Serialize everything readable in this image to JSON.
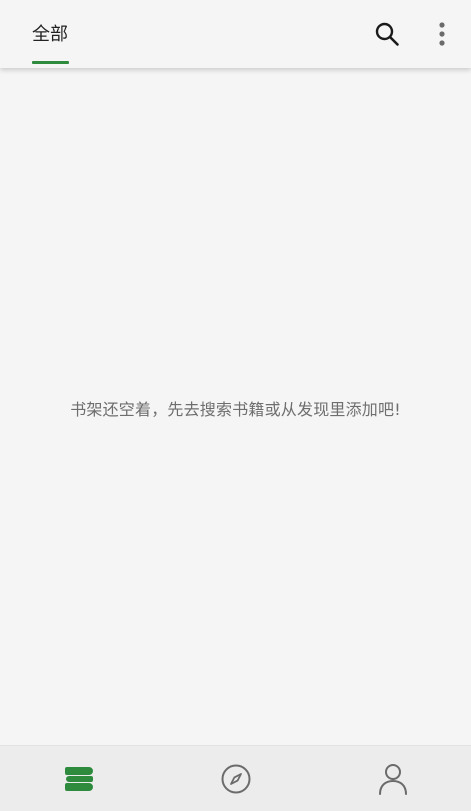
{
  "header": {
    "tabs": [
      {
        "label": "全部",
        "active": true
      }
    ],
    "actions": [
      {
        "icon": "search-icon"
      },
      {
        "icon": "more-vertical-icon"
      }
    ]
  },
  "main": {
    "empty_message": "书架还空着，先去搜索书籍或从发现里添加吧!"
  },
  "bottom_nav": {
    "items": [
      {
        "icon": "bookshelf-icon",
        "active": true
      },
      {
        "icon": "compass-icon",
        "active": false
      },
      {
        "icon": "profile-icon",
        "active": false
      }
    ]
  },
  "colors": {
    "accent": "#2e8b3e",
    "background": "#f5f5f5",
    "nav_background": "#ececec",
    "icon_inactive": "#6b6b6b",
    "text_muted": "#6e6e6e"
  }
}
